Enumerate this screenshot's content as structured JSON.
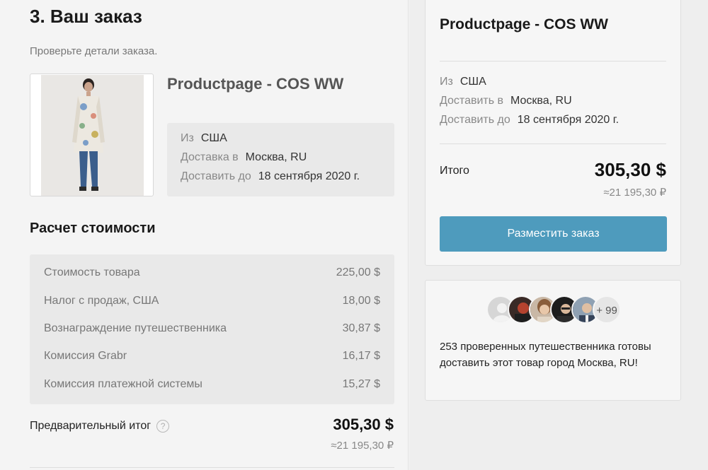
{
  "order": {
    "title": "3. Ваш заказ",
    "subtitle": "Проверьте детали заказа.",
    "product_name": "Productpage - COS WW",
    "shipping": [
      {
        "key": "Из",
        "value": "США"
      },
      {
        "key": "Доставка в",
        "value": "Москва, RU"
      },
      {
        "key": "Доставить до",
        "value": "18 сентября 2020 г."
      }
    ]
  },
  "cost": {
    "title": "Расчет стоимости",
    "rows": [
      {
        "label": "Стоимость товара",
        "value": "225,00 $"
      },
      {
        "label": "Налог с продаж, США",
        "value": "18,00 $"
      },
      {
        "label": "Вознаграждение путешественника",
        "value": "30,87 $"
      },
      {
        "label": "Комиссия Grabr",
        "value": "16,17 $"
      },
      {
        "label": "Комиссия платежной системы",
        "value": "15,27 $"
      }
    ],
    "subtotal_label": "Предварительный итог",
    "help_glyph": "?",
    "subtotal_amount": "305,30 $",
    "subtotal_rub": "≈21 195,30 ₽"
  },
  "summary": {
    "title": "Productpage - COS WW",
    "rows": [
      {
        "key": "Из",
        "value": "США"
      },
      {
        "key": "Доставить в",
        "value": "Москва, RU"
      },
      {
        "key": "Доставить до",
        "value": "18 сентября 2020 г."
      }
    ],
    "total_label": "Итого",
    "total_amount": "305,30 $",
    "total_rub": "≈21 195,30 ₽",
    "button_label": "Разместить заказ",
    "button_color": "#4e9bbd"
  },
  "travelers": {
    "more_count": "+ 99",
    "text": "253 проверенных путешественника готовы доставить этот товар город Москва, RU!"
  }
}
